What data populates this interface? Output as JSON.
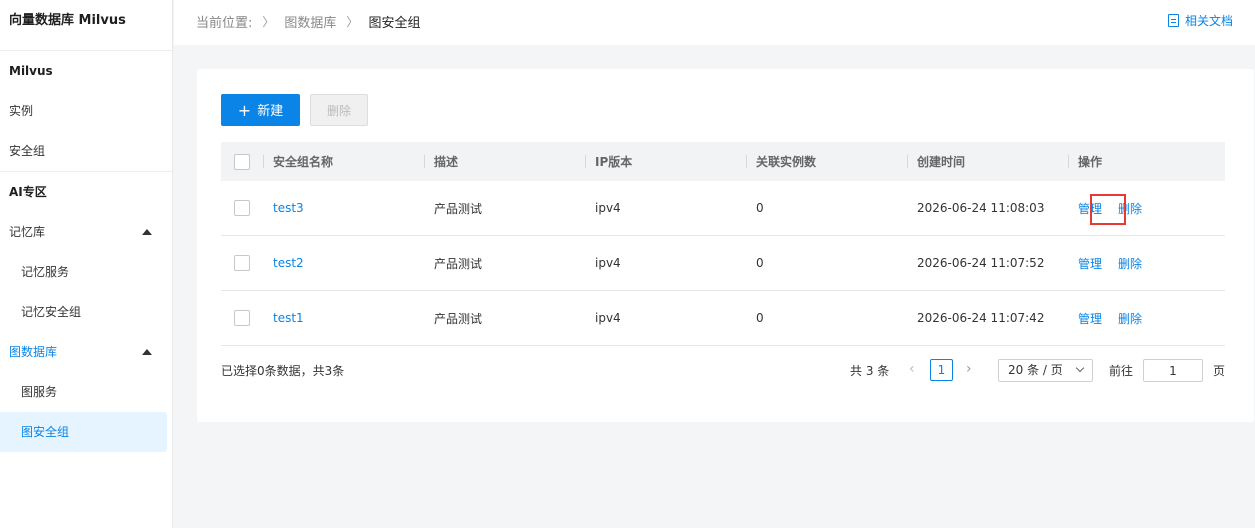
{
  "sidebar": {
    "title": "向量数据库 Milvus",
    "groups": [
      {
        "label": "Milvus"
      },
      {
        "label": "AI专区"
      }
    ],
    "items": {
      "instance": "实例",
      "security_group": "安全组",
      "memory_lib": "记忆库",
      "memory_service": "记忆服务",
      "memory_sg": "记忆安全组",
      "graph_db": "图数据库",
      "graph_service": "图服务",
      "graph_sg": "图安全组"
    }
  },
  "header": {
    "breadcrumb_prefix": "当前位置:",
    "breadcrumb": [
      "图数据库",
      "图安全组"
    ],
    "doc_link": "相关文档"
  },
  "toolbar": {
    "new_label": "新建",
    "new_icon": "+",
    "delete_label": "删除"
  },
  "table": {
    "columns": [
      "安全组名称",
      "描述",
      "IP版本",
      "关联实例数",
      "创建时间",
      "操作"
    ],
    "rows": [
      {
        "name": "test3",
        "desc": "产品测试",
        "ip": "ipv4",
        "count": "0",
        "time": "2026-06-24 11:08:03",
        "manage": "管理",
        "delete": "删除"
      },
      {
        "name": "test2",
        "desc": "产品测试",
        "ip": "ipv4",
        "count": "0",
        "time": "2026-06-24 11:07:52",
        "manage": "管理",
        "delete": "删除"
      },
      {
        "name": "test1",
        "desc": "产品测试",
        "ip": "ipv4",
        "count": "0",
        "time": "2026-06-24 11:07:42",
        "manage": "管理",
        "delete": "删除"
      }
    ]
  },
  "footer": {
    "selection_info": "已选择0条数据，共3条",
    "total": "共 3 条",
    "current_page": "1",
    "page_size": "20 条 / 页",
    "goto_label": "前往",
    "goto_value": "1",
    "page_unit": "页"
  },
  "colors": {
    "accent": "#0a84e6",
    "highlight": "#e53935"
  }
}
